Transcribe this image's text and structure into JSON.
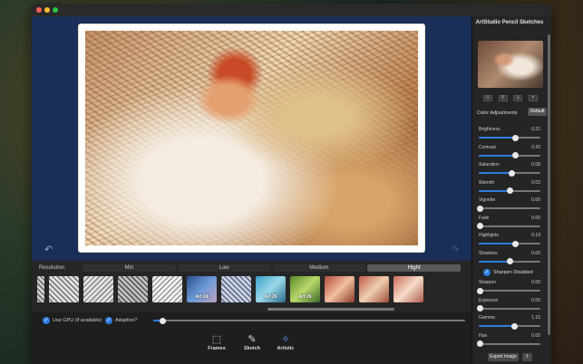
{
  "app": {
    "title": "ArtStudio Pencil Sketches"
  },
  "colors": {
    "accent": "#2f7de1",
    "canvas_bg": "#1a2f57",
    "panel_bg": "#252525"
  },
  "canvas": {
    "undo_icon": "undo-icon",
    "redo_icon": "redo-icon"
  },
  "resolution": {
    "label": "Resolution",
    "options": [
      "Min",
      "Low",
      "Medium",
      "Hight"
    ],
    "selected": "Hight"
  },
  "presets": {
    "thumbnails": [
      {
        "label": ""
      },
      {
        "label": ""
      },
      {
        "label": ""
      },
      {
        "label": ""
      },
      {
        "label": ""
      },
      {
        "label": "Art 24"
      },
      {
        "label": ""
      },
      {
        "label": "Art 26"
      },
      {
        "label": "Art 26"
      },
      {
        "label": ""
      },
      {
        "label": ""
      },
      {
        "label": ""
      }
    ]
  },
  "options": {
    "use_gpu": {
      "label": "Use GPU (if available)",
      "checked": true
    },
    "adaptive": {
      "label": "Adaptive?",
      "checked": true,
      "level": 0.03
    }
  },
  "modes": [
    {
      "label": "Frames",
      "icon": "frame-icon"
    },
    {
      "label": "Sketch",
      "icon": "pencil-icon"
    },
    {
      "label": "Artistic",
      "icon": "magic-wand-icon"
    }
  ],
  "panel": {
    "tools": [
      "crop-icon",
      "rotate-icon",
      "person-icon",
      "trash-icon"
    ],
    "color_adjustments_label": "Color Adjustments",
    "default_button": "Default",
    "adjustments": [
      {
        "name": "Brightness",
        "value": "0.21",
        "level": 0.6
      },
      {
        "name": "Contrast",
        "value": "0.20",
        "level": 0.6
      },
      {
        "name": "Saturation",
        "value": "0.08",
        "level": 0.54
      },
      {
        "name": "Warmth",
        "value": "0.02",
        "level": 0.51
      },
      {
        "name": "Vignette",
        "value": "0.00",
        "level": 0.02
      },
      {
        "name": "Fade",
        "value": "0.00",
        "level": 0.02
      },
      {
        "name": "Highlights",
        "value": "0.19",
        "level": 0.6
      },
      {
        "name": "Shadows",
        "value": "0.00",
        "level": 0.5
      }
    ],
    "sharpen": {
      "label": "Sharpen Disabled",
      "checked": true
    },
    "adjustments2": [
      {
        "name": "Sharpen",
        "value": "0.00",
        "level": 0.02
      },
      {
        "name": "Exposure",
        "value": "0.00",
        "level": 0.02
      },
      {
        "name": "Gamma",
        "value": "1.15",
        "level": 0.58
      },
      {
        "name": "Hue",
        "value": "0.00",
        "level": 0.02
      }
    ],
    "export_button": "Export Image",
    "share_icon": "share-icon"
  }
}
